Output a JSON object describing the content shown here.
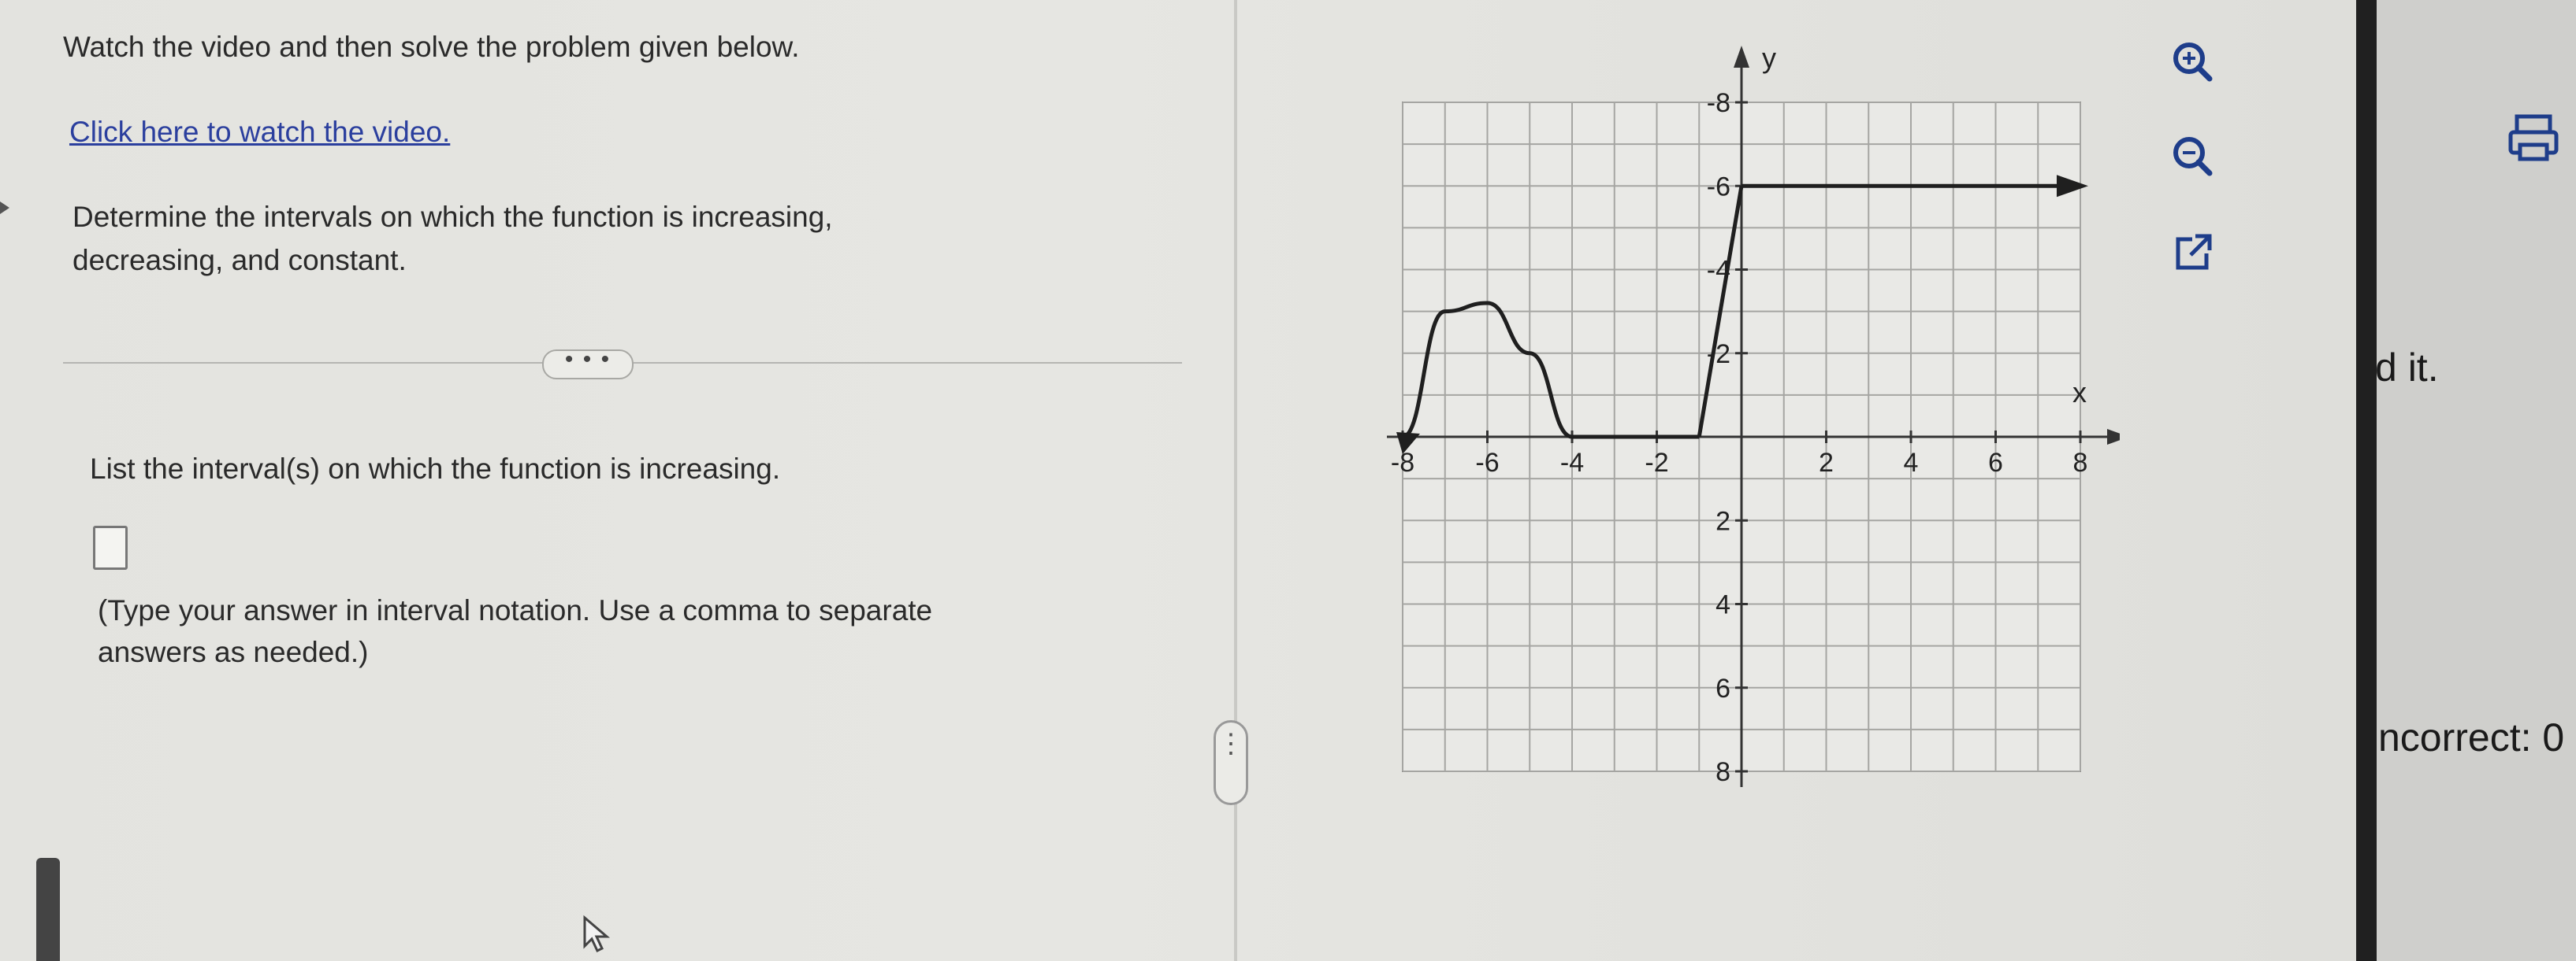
{
  "problem": {
    "instruction": "Watch the video and then solve the problem given below.",
    "video_link": "Click here to watch the video.",
    "prompt_line1": "Determine the intervals on which the function is increasing,",
    "prompt_line2": "decreasing, and constant.",
    "more_label": "• • •",
    "question": "List the interval(s) on which the function is  increasing.",
    "hint_line1": "(Type your answer in interval notation. Use a comma to separate",
    "hint_line2": "answers as needed.)",
    "answer_value": ""
  },
  "splitter": {
    "handle_label": "⋮"
  },
  "graph": {
    "x_label": "x",
    "y_label": "y",
    "x_tick_labels": [
      "-8",
      "-6",
      "-4",
      "-2",
      "2",
      "4",
      "6",
      "8"
    ],
    "y_tick_labels": [
      "8",
      "6",
      "4",
      "2",
      "-2",
      "-4",
      "-6",
      "-8"
    ],
    "curve_color": "#1f1f1f"
  },
  "chart_data": {
    "type": "line",
    "xlim": [
      -8,
      8
    ],
    "ylim": [
      -8,
      8
    ],
    "grid": true,
    "xlabel": "x",
    "ylabel": "y",
    "x_ticks": [
      -8,
      -6,
      -4,
      -2,
      2,
      4,
      6,
      8
    ],
    "y_ticks": [
      -8,
      -6,
      -4,
      -2,
      2,
      4,
      6,
      8
    ],
    "pieces": [
      {
        "kind": "parabola",
        "x": [
          -8,
          -7,
          -6,
          -5,
          -4
        ],
        "y": [
          0,
          3,
          3.2,
          2,
          0
        ],
        "left_endpoint": "arrow"
      },
      {
        "kind": "segment",
        "x": [
          -4,
          -1
        ],
        "y": [
          0,
          0
        ]
      },
      {
        "kind": "segment",
        "x": [
          -1,
          0
        ],
        "y": [
          0,
          6
        ]
      },
      {
        "kind": "segment",
        "x": [
          0,
          8
        ],
        "y": [
          6,
          6
        ],
        "right_endpoint": "arrow"
      }
    ]
  },
  "toolbar": {
    "zoom_in_icon": "zoom-in-icon",
    "zoom_out_icon": "zoom-out-icon",
    "popout_icon": "external-link-icon",
    "print_icon": "print-icon"
  },
  "right_panel": {
    "fragment_1": "d it.",
    "fragment_2": "ncorrect: 0"
  }
}
